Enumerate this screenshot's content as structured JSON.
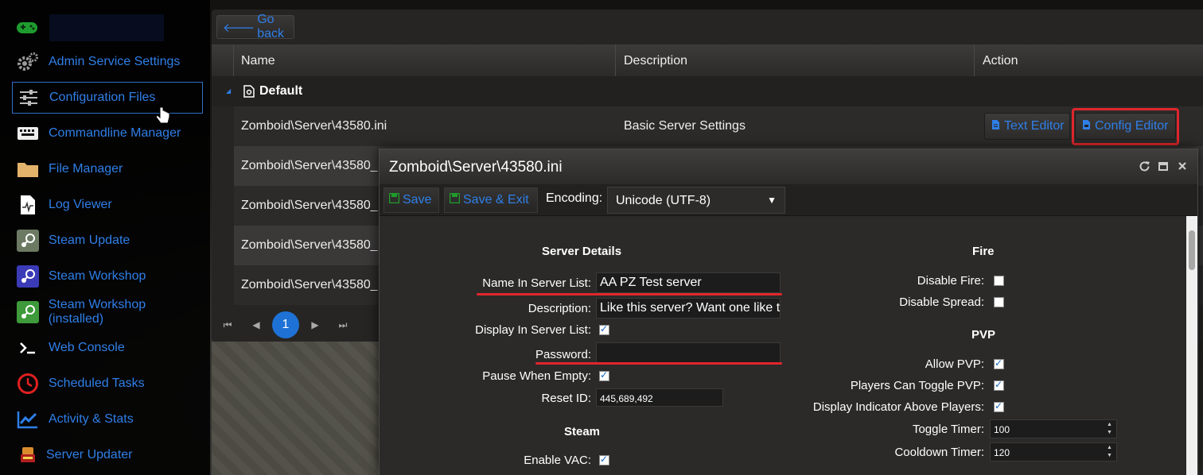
{
  "sidebar": {
    "items": [
      {
        "label": "Admin Service Settings",
        "icon": "gears-icon"
      },
      {
        "label": "Configuration Files",
        "icon": "sliders-icon",
        "active": true
      },
      {
        "label": "Commandline Manager",
        "icon": "keyboard-icon"
      },
      {
        "label": "File Manager",
        "icon": "folder-icon"
      },
      {
        "label": "Log Viewer",
        "icon": "log-file-icon"
      },
      {
        "label": "Steam Update",
        "icon": "steam-icon"
      },
      {
        "label": "Steam Workshop",
        "icon": "steam-icon"
      },
      {
        "label": "Steam Workshop (installed)",
        "icon": "steam-icon"
      },
      {
        "label": "Web Console",
        "icon": "terminal-icon"
      },
      {
        "label": "Scheduled Tasks",
        "icon": "clock-icon"
      },
      {
        "label": "Activity & Stats",
        "icon": "chart-icon"
      },
      {
        "label": "Server Updater",
        "icon": "updater-icon"
      }
    ]
  },
  "main": {
    "go_back": "Go back",
    "columns": {
      "name": "Name",
      "description": "Description",
      "action": "Action"
    },
    "group": "Default",
    "rows": [
      {
        "name": "Zomboid\\Server\\43580.ini",
        "description": "Basic Server Settings"
      },
      {
        "name": "Zomboid\\Server\\43580_",
        "description": ""
      },
      {
        "name": "Zomboid\\Server\\43580_",
        "description": ""
      },
      {
        "name": "Zomboid\\Server\\43580_",
        "description": ""
      },
      {
        "name": "Zomboid\\Server\\43580_",
        "description": ""
      }
    ],
    "actions": {
      "text_editor": "Text Editor",
      "config_editor": "Config Editor"
    },
    "pager": {
      "current": "1"
    }
  },
  "modal": {
    "title": "Zomboid\\Server\\43580.ini",
    "toolbar": {
      "save": "Save",
      "save_exit": "Save & Exit",
      "encoding_label": "Encoding:",
      "encoding_value": "Unicode (UTF-8)"
    },
    "server_details": {
      "title": "Server Details",
      "name_label": "Name In Server List:",
      "name_value": "AA PZ Test server",
      "description_label": "Description:",
      "description_value": "Like this server? Want one like tl",
      "display_label": "Display In Server List:",
      "display_checked": true,
      "password_label": "Password:",
      "password_value": "",
      "pause_label": "Pause When Empty:",
      "pause_checked": true,
      "reset_label": "Reset ID:",
      "reset_value": "445,689,492"
    },
    "steam": {
      "title": "Steam",
      "vac_label": "Enable VAC:",
      "vac_checked": true
    },
    "fire": {
      "title": "Fire",
      "disable_fire_label": "Disable Fire:",
      "disable_fire_checked": false,
      "disable_spread_label": "Disable Spread:",
      "disable_spread_checked": false
    },
    "pvp": {
      "title": "PVP",
      "allow_label": "Allow PVP:",
      "allow_checked": true,
      "toggle_label": "Players Can Toggle PVP:",
      "toggle_checked": true,
      "indicator_label": "Display Indicator Above Players:",
      "indicator_checked": true,
      "toggle_timer_label": "Toggle Timer:",
      "toggle_timer_value": "100",
      "cooldown_label": "Cooldown Timer:",
      "cooldown_value": "120"
    }
  },
  "colors": {
    "accent": "#2f7fe8",
    "highlight": "#e0262b",
    "checkbox": "#1565c0"
  }
}
